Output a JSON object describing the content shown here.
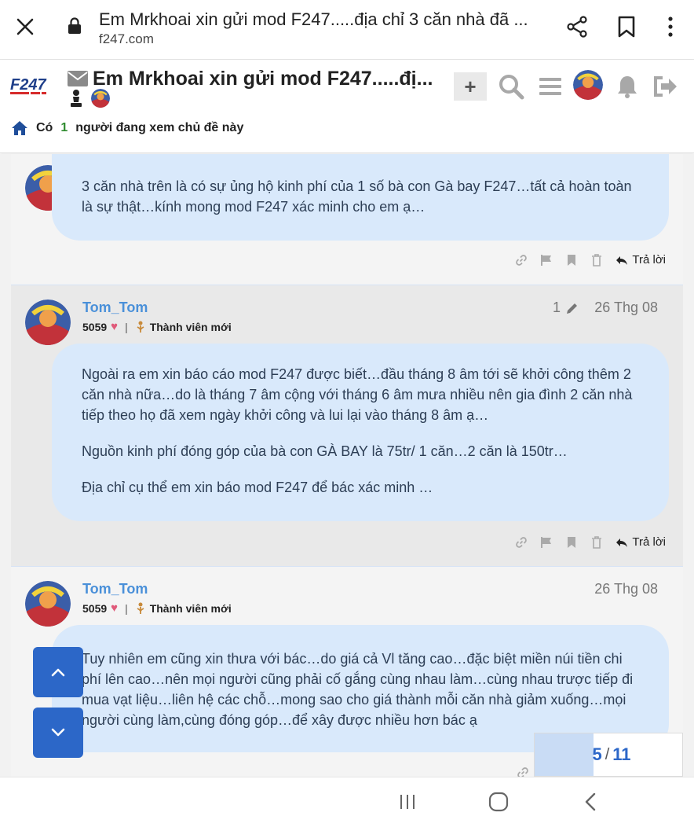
{
  "browser": {
    "title": "Em Mrkhoai xin gửi mod F247.....địa chỉ 3 căn nhà đã ...",
    "url": "f247.com",
    "icons": [
      "close-icon",
      "lock-icon",
      "share-icon",
      "bookmark-icon",
      "more-vert-icon"
    ]
  },
  "header": {
    "logo_text": "F247",
    "topic_title": "Em Mrkhoai xin gửi mod F247.....đị...",
    "plus_label": "+",
    "viewers": {
      "prefix": "Có",
      "count": "1",
      "suffix": "người đang xem chủ đề này"
    },
    "icons": [
      "envelope-icon",
      "chess-piece-icon",
      "plus-icon",
      "search-icon",
      "hamburger-icon",
      "user-avatar",
      "bell-icon",
      "exit-icon",
      "home-icon"
    ]
  },
  "posts": [
    {
      "paragraphs": [
        "3 căn nhà trên là có sự ủng hộ kinh phí của 1 số bà con Gà bay F247…tất cả hoàn toàn là sự thật…kính mong mod F247 xác minh cho em ạ…"
      ],
      "reply_label": "Trả lời"
    },
    {
      "username": "Tom_Tom",
      "likes": "5059",
      "rank": "Thành viên mới",
      "edit_count": "1",
      "date": "26 Thg 08",
      "paragraphs": [
        "Ngoài ra em xin báo cáo mod F247 được biết…đầu tháng 8 âm tới sẽ khởi công thêm 2 căn nhà nữa…do là tháng 7 âm cộng với tháng 6 âm mưa nhiều nên gia đình 2 căn nhà tiếp theo họ đã xem ngày khởi công và lui lại vào tháng 8 âm ạ…",
        "Nguồn kinh phí đóng góp của bà con GÀ BAY là 75tr/ 1 căn…2 căn là 150tr…",
        "Địa chỉ cụ thể em xin báo mod F247 để bác xác minh …"
      ],
      "reply_label": "Trả lời"
    },
    {
      "username": "Tom_Tom",
      "likes": "5059",
      "rank": "Thành viên mới",
      "date": "26 Thg 08",
      "paragraphs": [
        "Tuy nhiên em cũng xin thưa với bác…do giá cả Vl tăng cao…đặc biệt miền núi tiền chi phí lên cao…nên mọi người cũng phải cố gắng cùng nhau làm…cùng nhau trược tiếp đi mua vạt liệu…liên hệ các chỗ…mong sao cho giá thành mỗi căn nhà giảm xuống…mọi người cùng làm,cùng đóng góp…để xây được nhiều hơn bác ạ"
      ]
    }
  ],
  "progress": {
    "current": "5",
    "separator": "/",
    "total": "11",
    "fraction": 0.4
  },
  "colors": {
    "accent": "#2c67c8",
    "username": "#4a90d9",
    "bubble": "#d9e9fb",
    "heart": "#e05a7a",
    "viewer_count": "#2e8b2e"
  },
  "android_nav": [
    "recent-apps-icon",
    "home-button-icon",
    "back-icon"
  ]
}
